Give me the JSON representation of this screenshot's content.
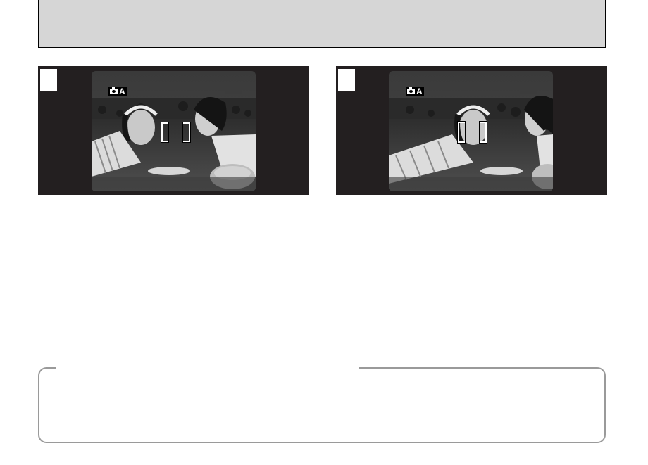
{
  "header": {
    "background": "#d6d6d6"
  },
  "figures": [
    {
      "id": "fig-1",
      "mode_badge": "A",
      "mode_icon": "camera-icon",
      "focus_frame": "centered-between-subjects"
    },
    {
      "id": "fig-2",
      "mode_badge": "A",
      "mode_icon": "camera-icon",
      "focus_frame": "on-left-subject-face"
    }
  ],
  "note": {
    "border_color": "#9a9a9a"
  }
}
